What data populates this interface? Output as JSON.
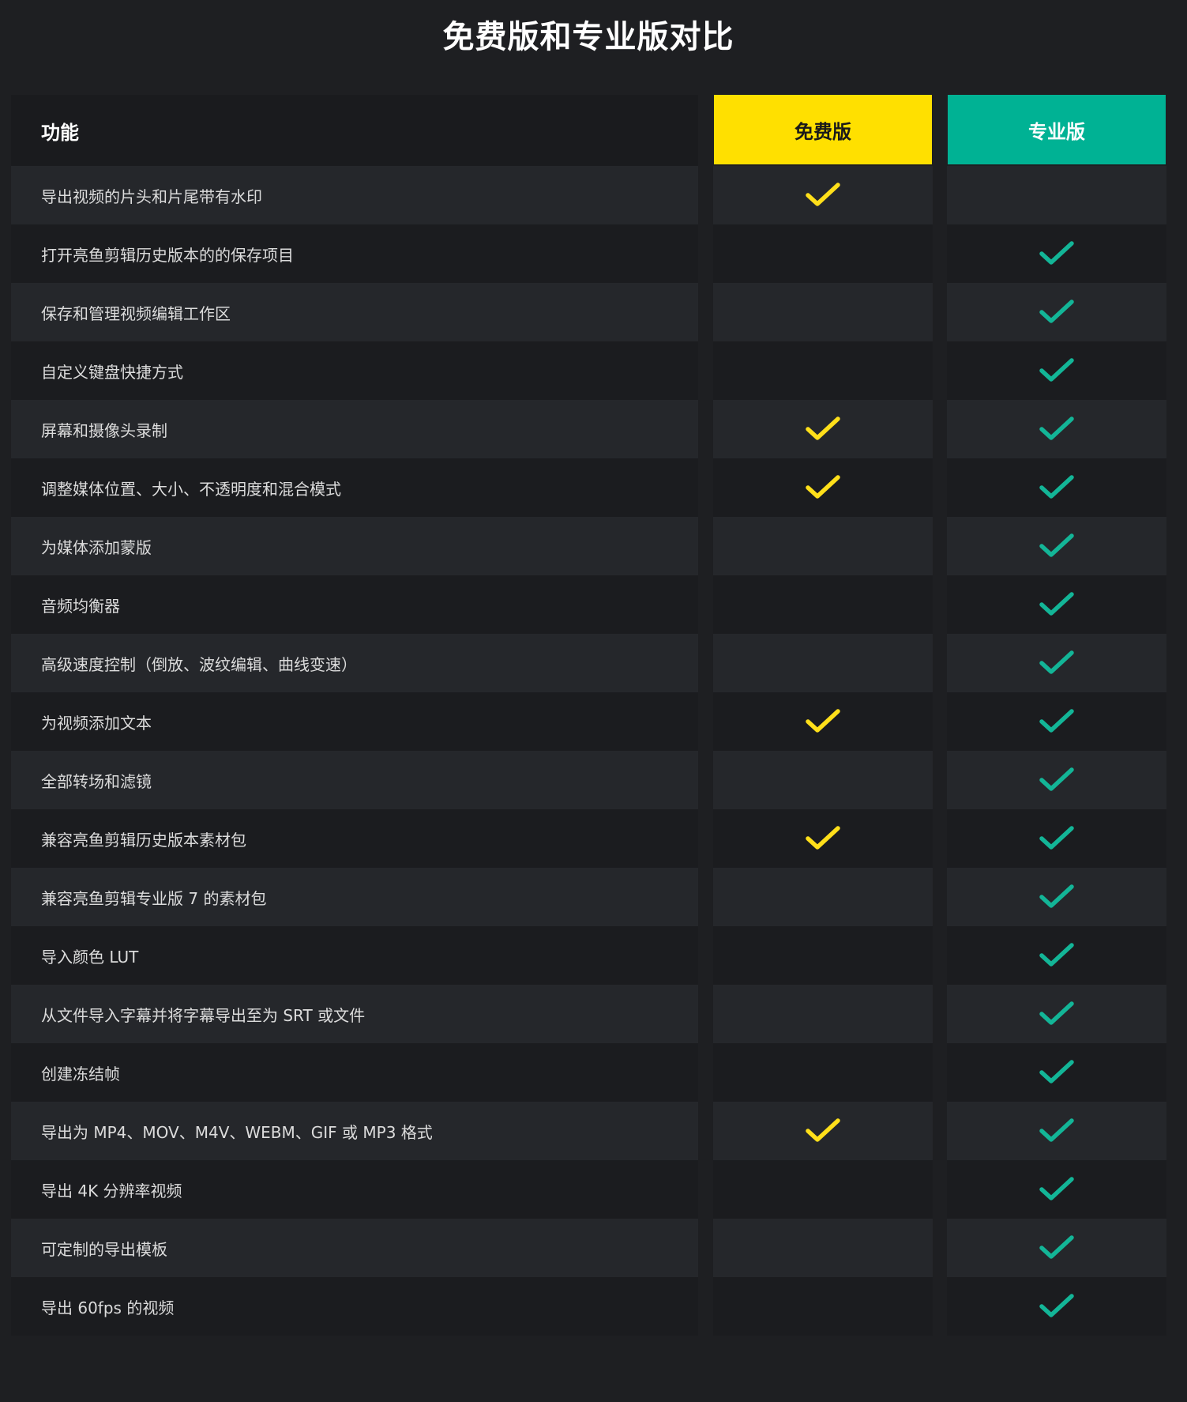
{
  "title": "免费版和专业版对比",
  "colors": {
    "free_header": "#ffe000",
    "pro_header": "#00b294",
    "free_check": "#ffdf1a",
    "pro_check": "#13b597",
    "background": "#1e1f22"
  },
  "header": {
    "feature": "功能",
    "free": "免费版",
    "pro": "专业版"
  },
  "check_icon": "checkmark-icon",
  "rows": [
    {
      "feature": "导出视频的片头和片尾带有水印",
      "free": true,
      "pro": false
    },
    {
      "feature": "打开亮鱼剪辑历史版本的的保存项目",
      "free": false,
      "pro": true
    },
    {
      "feature": "保存和管理视频编辑工作区",
      "free": false,
      "pro": true
    },
    {
      "feature": "自定义键盘快捷方式",
      "free": false,
      "pro": true
    },
    {
      "feature": "屏幕和摄像头录制",
      "free": true,
      "pro": true
    },
    {
      "feature": "调整媒体位置、大小、不透明度和混合模式",
      "free": true,
      "pro": true
    },
    {
      "feature": "为媒体添加蒙版",
      "free": false,
      "pro": true
    },
    {
      "feature": "音频均衡器",
      "free": false,
      "pro": true
    },
    {
      "feature": "高级速度控制（倒放、波纹编辑、曲线变速）",
      "free": false,
      "pro": true
    },
    {
      "feature": "为视频添加文本",
      "free": true,
      "pro": true
    },
    {
      "feature": "全部转场和滤镜",
      "free": false,
      "pro": true
    },
    {
      "feature": "兼容亮鱼剪辑历史版本素材包",
      "free": true,
      "pro": true
    },
    {
      "feature": "兼容亮鱼剪辑专业版 7 的素材包",
      "free": false,
      "pro": true
    },
    {
      "feature": "导入颜色 LUT",
      "free": false,
      "pro": true
    },
    {
      "feature": "从文件导入字幕并将字幕导出至为 SRT 或文件",
      "free": false,
      "pro": true
    },
    {
      "feature": "创建冻结帧",
      "free": false,
      "pro": true
    },
    {
      "feature": "导出为 MP4、MOV、M4V、WEBM、GIF 或 MP3 格式",
      "free": true,
      "pro": true
    },
    {
      "feature": "导出 4K 分辨率视频",
      "free": false,
      "pro": true
    },
    {
      "feature": "可定制的导出模板",
      "free": false,
      "pro": true
    },
    {
      "feature": "导出 60fps 的视频",
      "free": false,
      "pro": true
    }
  ]
}
